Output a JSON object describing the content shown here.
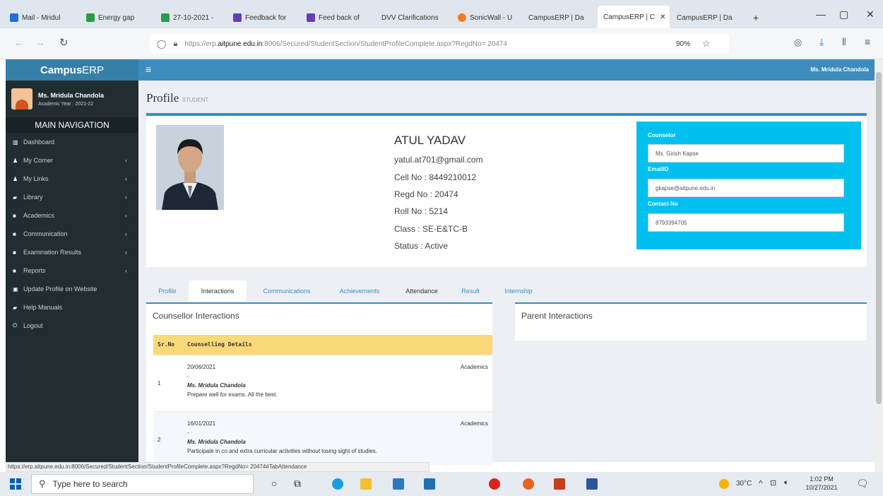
{
  "browser": {
    "tabs": [
      {
        "label": "Mail - Mridul"
      },
      {
        "label": "Energy gap"
      },
      {
        "label": "27-10-2021 -"
      },
      {
        "label": "Feedback for"
      },
      {
        "label": "Feed back of"
      },
      {
        "label": "DVV Clarifications"
      },
      {
        "label": "SonicWall - U"
      },
      {
        "label": "CampusERP | Da"
      },
      {
        "label": "CampusERP | C"
      },
      {
        "label": "CampusERP | Da"
      }
    ],
    "new_tab": "+",
    "url_prefix": "https://erp.",
    "url_domain": "aitpune.edu.in",
    "url_rest": ":8006/Secured/StudentSection/StudentProfileComplete.aspx?RegdNo= 20474",
    "zoom": "90%",
    "window_controls": {
      "minimize": "—",
      "maximize": "▢",
      "close": "✕"
    }
  },
  "app": {
    "brand_prefix": "Campus",
    "brand_suffix": "ERP",
    "menu_toggle": "≡",
    "topbar_user": "Ms. Mridula Chandola",
    "user": {
      "name": "Ms. Mridula Chandola",
      "academic_year": "Academic Year : 2021-22"
    },
    "main_nav_title": "MAIN NAVIGATION",
    "nav_items": [
      {
        "label": "Dashboard",
        "icon": "▥",
        "has_children": false
      },
      {
        "label": "My Corner",
        "icon": "♟",
        "has_children": true
      },
      {
        "label": "My Links",
        "icon": "♟",
        "has_children": true
      },
      {
        "label": "Library",
        "icon": "▰",
        "has_children": true
      },
      {
        "label": "Academics",
        "icon": "■",
        "has_children": true
      },
      {
        "label": "Communication",
        "icon": "■",
        "has_children": true
      },
      {
        "label": "Examination Results",
        "icon": "■",
        "has_children": true
      },
      {
        "label": "Reports",
        "icon": "■",
        "has_children": true
      },
      {
        "label": "Update Profile on Website",
        "icon": "▣",
        "has_children": false
      },
      {
        "label": "Help Manuals",
        "icon": "▰",
        "has_children": false
      },
      {
        "label": "Logout",
        "icon": "⏻",
        "has_children": false
      }
    ],
    "chevron": "‹"
  },
  "page": {
    "title": "Profile",
    "subtitle": "STUDENT"
  },
  "student": {
    "name": "ATUL YADAV",
    "email": "yatul.at701@gmail.com",
    "cell": "Cell No : 8449210012",
    "regd": "Regd No : 20474",
    "roll": "Roll No : 5214",
    "class": "Class : SE-E&TC-B",
    "status": "Status : Active"
  },
  "counsellor": {
    "label": "Counselor",
    "name": "Ms. Girish Kapse",
    "email_label": "EmailID",
    "email": "gkapse@aitpune.edu.in",
    "contact_label": "Contact No",
    "contact": "8793394705"
  },
  "tabs": [
    "Profile",
    "Interactions",
    "Communications",
    "Achievements",
    "Attendance",
    "Result",
    "Internship"
  ],
  "counsellor_interactions": {
    "title": "Counsellor Interactions",
    "columns": [
      "Sr.No",
      "Counselling Details"
    ],
    "rows": [
      {
        "no": "1",
        "date": "20/06/2021",
        "dash": "-",
        "category": "Academics",
        "by": "Ms. Mridula Chandola",
        "note": "Prepare well for exams. All the best."
      },
      {
        "no": "2",
        "date": "16/01/2021",
        "dash": "-",
        "category": "Academics",
        "by": "Ms. Mridula Chandola",
        "note": "Participate in co and extra curricular activities without losing sight of studies."
      }
    ]
  },
  "parent_interactions": {
    "title": "Parent Interactions"
  },
  "status_url": "https://erp.aitpune.edu.in:8006/Secured/StudentSection/StudentProfileComplete.aspx?RegdNo= 20474#TabAttendance",
  "taskbar": {
    "search_placeholder": "Type here to search",
    "weather": "30°C",
    "time": "1:02 PM",
    "date": "10/27/2021"
  }
}
